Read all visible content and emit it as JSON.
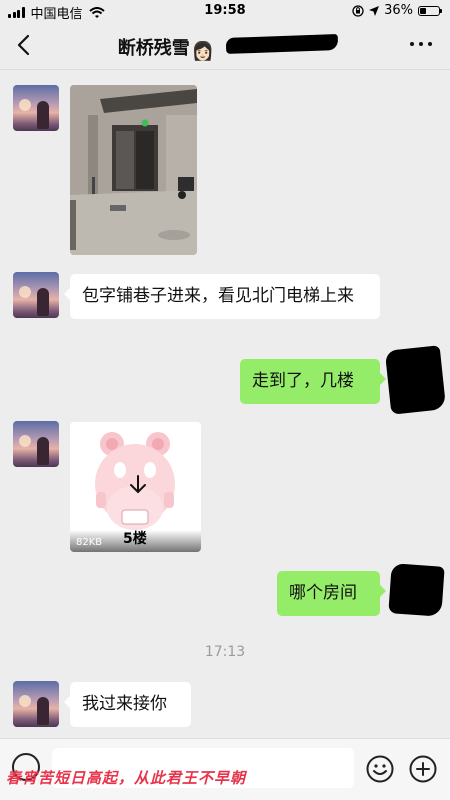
{
  "status_bar": {
    "carrier": "中国电信",
    "time": "19:58",
    "battery_percent": "36%",
    "battery_level": 0.36
  },
  "nav": {
    "title": "断桥残雪",
    "title_emoji": "👩🏻"
  },
  "messages": [
    {
      "type": "image",
      "direction": "in"
    },
    {
      "type": "text",
      "direction": "in",
      "text": "包字铺巷子进来，看见北门电梯上来"
    },
    {
      "type": "text",
      "direction": "out",
      "text": "走到了，几楼"
    },
    {
      "type": "sticker",
      "direction": "in",
      "size": "82KB",
      "caption": "5楼"
    },
    {
      "type": "text",
      "direction": "out",
      "text": "哪个房间"
    },
    {
      "type": "time",
      "text": "17:13"
    },
    {
      "type": "text",
      "direction": "in",
      "text": "我过来接你"
    }
  ],
  "watermark": "春宵苦短日高起，从此君王不早朝",
  "colors": {
    "background": "#ededed",
    "outgoing_bubble": "#95ec69",
    "incoming_bubble": "#ffffff",
    "watermark": "#e8344b"
  },
  "icons": [
    "back-icon",
    "more-icon",
    "wifi-icon",
    "lock-rotation-icon",
    "location-icon",
    "battery-icon",
    "voice-icon",
    "emoji-icon",
    "plus-icon",
    "download-icon"
  ]
}
